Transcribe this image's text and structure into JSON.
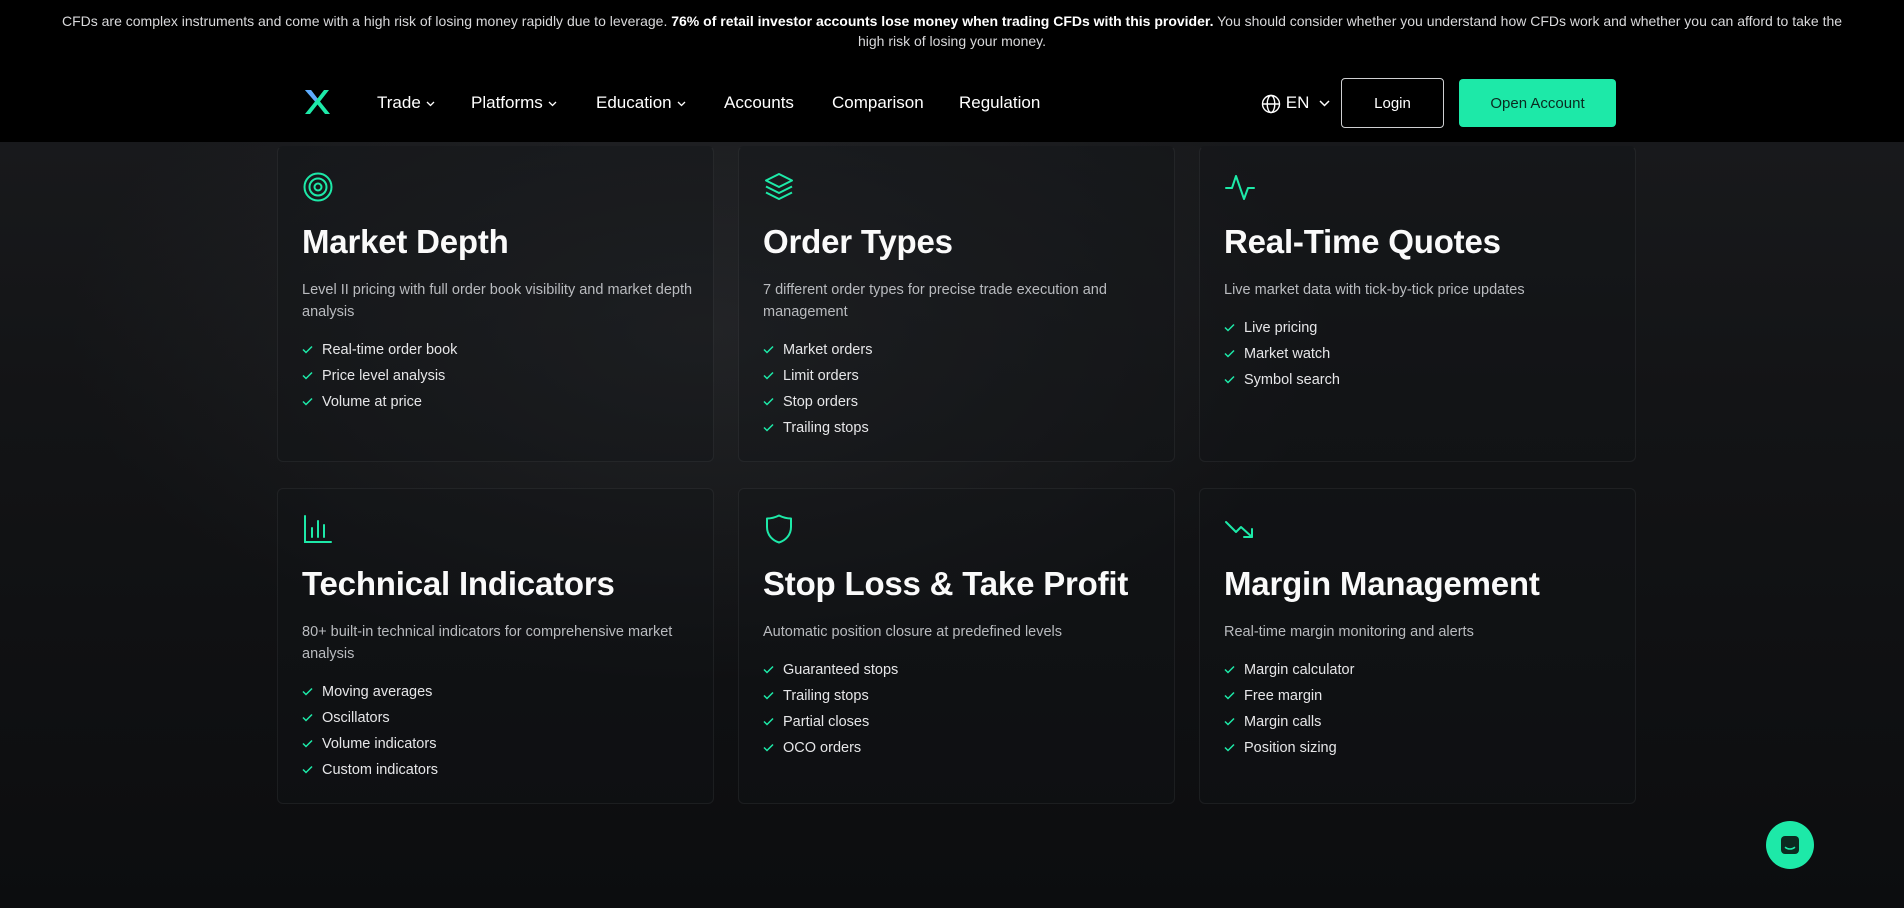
{
  "risk_banner": {
    "text_before": "CFDs are complex instruments and come with a high risk of losing money rapidly due to leverage. ",
    "text_bold": "76% of retail investor accounts lose money when trading CFDs with this provider.",
    "text_after": " You should consider whether you understand how CFDs work and whether you can afford to take the high risk of losing your money."
  },
  "nav": {
    "items": [
      {
        "label": "Trade",
        "dropdown": true
      },
      {
        "label": "Platforms",
        "dropdown": true
      },
      {
        "label": "Education",
        "dropdown": true
      },
      {
        "label": "Accounts",
        "dropdown": false
      },
      {
        "label": "Comparison",
        "dropdown": false
      },
      {
        "label": "Regulation",
        "dropdown": false
      }
    ],
    "language": "EN",
    "login_label": "Login",
    "open_account_label": "Open Account"
  },
  "colors": {
    "accent": "#1de9a8",
    "background": "#0d0e10",
    "nav_background": "#000000"
  },
  "features": [
    {
      "icon": "target-icon",
      "title": "Market Depth",
      "description": "Level II pricing with full order book visibility and market depth analysis",
      "items": [
        "Real-time order book",
        "Price level analysis",
        "Volume at price"
      ]
    },
    {
      "icon": "layers-icon",
      "title": "Order Types",
      "description": "7 different order types for precise trade execution and management",
      "items": [
        "Market orders",
        "Limit orders",
        "Stop orders",
        "Trailing stops"
      ]
    },
    {
      "icon": "activity-icon",
      "title": "Real-Time Quotes",
      "description": "Live market data with tick-by-tick price updates",
      "items": [
        "Live pricing",
        "Market watch",
        "Symbol search"
      ]
    },
    {
      "icon": "bar-chart-icon",
      "title": "Technical Indicators",
      "description": "80+ built-in technical indicators for comprehensive market analysis",
      "items": [
        "Moving averages",
        "Oscillators",
        "Volume indicators",
        "Custom indicators"
      ]
    },
    {
      "icon": "shield-icon",
      "title": "Stop Loss & Take Profit",
      "description": "Automatic position closure at predefined levels",
      "items": [
        "Guaranteed stops",
        "Trailing stops",
        "Partial closes",
        "OCO orders"
      ]
    },
    {
      "icon": "trending-down-icon",
      "title": "Margin Management",
      "description": "Real-time margin monitoring and alerts",
      "items": [
        "Margin calculator",
        "Free margin",
        "Margin calls",
        "Position sizing"
      ]
    }
  ],
  "chat_widget": {
    "icon": "chat-icon"
  }
}
